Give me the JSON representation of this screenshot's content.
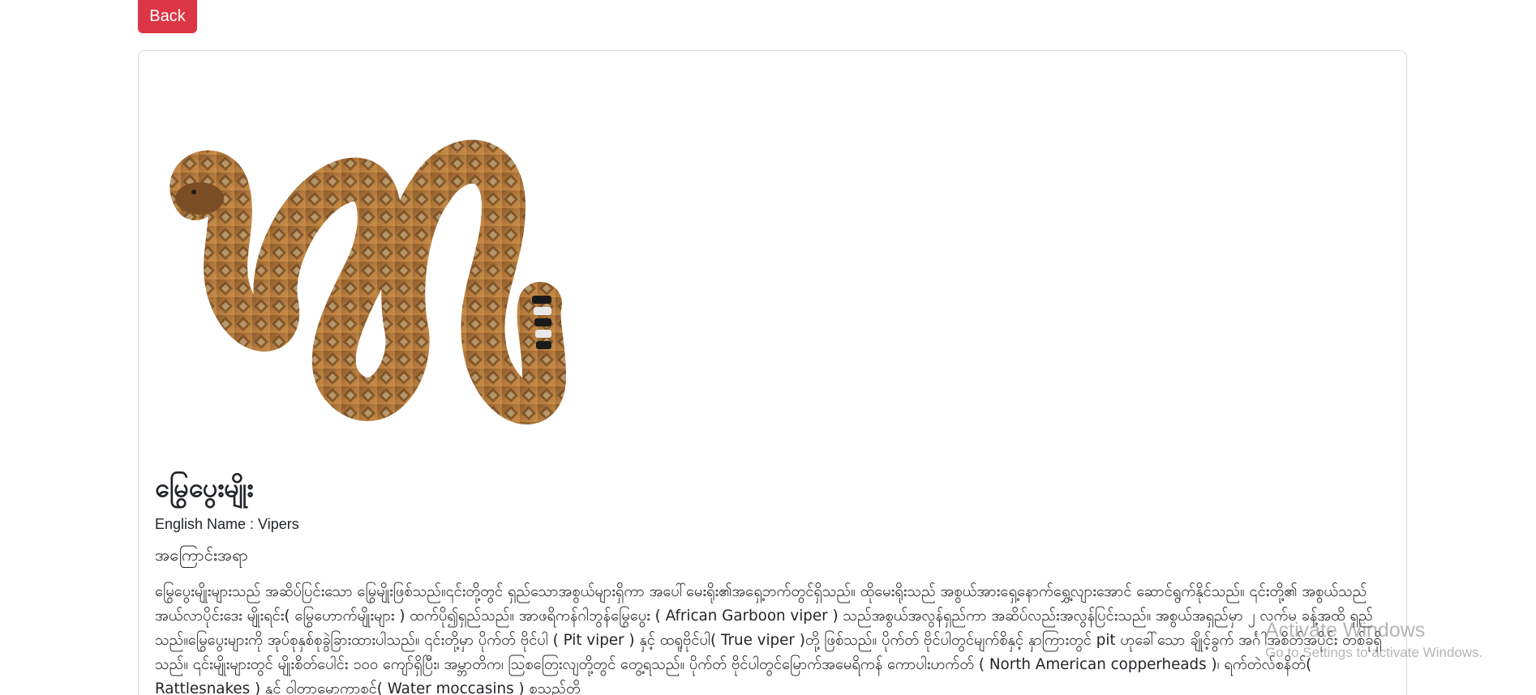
{
  "back_button": {
    "label": "Back"
  },
  "card": {
    "image_alt": "viper snake image",
    "title": "မြွေပွေးမျိုး",
    "english_name": "English Name : Vipers",
    "section_label": "အကြောင်းအရာ",
    "description": "မြွေပွေးမျိုးများသည် အဆိပ်ပြင်းသော မြွေမျိုးဖြစ်သည်။၎င်းတို့တွင် ရှည်သောအစွယ်များရှိကာ အပေါ်မေးရိုး၏အရှေ့ဘက်တွင်ရှိသည်။ ထိုမေးရိုးသည် အစွယ်အားရှေ့နောက်ရွှေ့လျားအောင် ဆောင်ရွက်နိုင်သည်။ ၎င်းတို့၏ အစွယ်သည် အယ်လာပိုင်းဒေး မျိုးရင်း( မြွေဟောက်မျိုးများ ) ထက်ပို၍ရှည်သည်။ အာဖရိကန်ဂါဘွန်မြွေပွေး ( African Garboon viper ) သည်အစွယ်အလွန်ရှည်ကာ အဆိပ်လည်းအလွန်ပြင်းသည်။ အစွယ်အရှည်မှာ ၂ လက်မ ခန့်အထိ ရှည်သည်။မြွေပွေးများကို အုပ်စုနှစ်စုခွဲခြားထားပါသည်။ ၎င်းတို့မှာ ပိုက်တ် ဗိုင်ပါ ( Pit viper ) နှင့် ထရူဗိုင်ပါ( True viper )တို့ ဖြစ်သည်။ ပိုက်တ် ဗိုင်ပါတွင်မျက်စိနှင့် နှာကြားတွင် pit ဟုခေါ်သော ချိုင့်ခွက် အင်္ဂါအစိတ်အပိုင်း တစ်ခုရှိသည်။ ၎င်းမျိုးများတွင် မျိုးစိတ်ပေါင်း ၁၀၀ ကျော်ရှိပြီး၊ အမ္ဘာတိက၊ ဩစတြေးလျတို့တွင် တွေ့ရသည်။ ပိုက်တ် ဗိုင်ပါတွင်မြောက်အမေရိကန် ကောပါးဟက်တ် ( North American copperheads )၊ ရက်တဲလ်စနိတ်( Rattlesnakes ) နှင့် ဝါတာမောကာစင်( Water moccasins ) စသည်တို့"
  },
  "watermark": {
    "title": "Activate Windows",
    "subtitle": "Go to Settings to activate Windows."
  },
  "colors": {
    "back_button_bg": "#dc3545",
    "card_border": "#dcdcdc",
    "text": "#212529"
  }
}
